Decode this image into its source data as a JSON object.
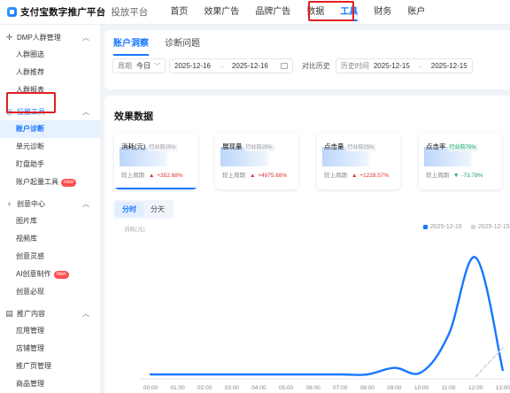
{
  "header": {
    "brand": "支付宝数字推广平台",
    "subtitle": "投放平台",
    "nav": [
      "首页",
      "效果广告",
      "品牌广告",
      "数据",
      "工具",
      "财务",
      "账户"
    ],
    "active_nav": "工具"
  },
  "sidebar": {
    "groups": [
      {
        "title": "DMP人群管理",
        "icon": "crosshair-icon",
        "items": [
          "人群圈选",
          "人群推荐",
          "人群报表"
        ]
      },
      {
        "title": "投放工具",
        "icon": "target-icon",
        "items": [
          "账户诊断",
          "单元诊断",
          "盯盘助手",
          "账户起量工具"
        ]
      },
      {
        "title": "创意中心",
        "icon": "bulb-icon",
        "items": [
          "图片库",
          "视频库",
          "创意灵感",
          "AI创意制作",
          "创意必现"
        ]
      },
      {
        "title": "推广内容",
        "icon": "doc-icon",
        "items": [
          "应用管理",
          "店铺管理",
          "推广页管理",
          "商品管理"
        ]
      }
    ],
    "active_item": "账户诊断",
    "badge_new": "new"
  },
  "tabs": [
    "账户洞察",
    "诊断问题"
  ],
  "filters": {
    "period_label": "周期",
    "period_value": "今日",
    "start": "2025-12-16",
    "end": "2025-12-16",
    "compare_label": "对比历史",
    "hist_label": "历史时间",
    "hist_start": "2025-12-15",
    "hist_end": "2025-12-15"
  },
  "section_title": "效果数据",
  "metrics": [
    {
      "name": "消耗(元)",
      "industry": "行业前25%",
      "compare_label": "较上周期",
      "change": "+352.68%",
      "trend": "up",
      "selected": true
    },
    {
      "name": "展现量",
      "industry": "行业前25%",
      "compare_label": "较上周期",
      "change": "+4975.68%",
      "trend": "up",
      "selected": false
    },
    {
      "name": "点击量",
      "industry": "行业前25%",
      "compare_label": "较上周期",
      "change": "+1228.57%",
      "trend": "up",
      "selected": false
    },
    {
      "name": "点击率",
      "industry": "行业前75%",
      "compare_label": "较上周期",
      "change": "-73.78%",
      "trend": "down",
      "selected": false
    }
  ],
  "segment": [
    "分时",
    "分天"
  ],
  "chart_data": {
    "type": "line",
    "ylabel": "消耗(元)",
    "x": [
      "00:00",
      "01:00",
      "02:00",
      "03:00",
      "04:00",
      "05:00",
      "06:00",
      "07:00",
      "08:00",
      "09:00",
      "10:00",
      "11:00",
      "12:00",
      "13:00"
    ],
    "series": [
      {
        "name": "2025-12-16",
        "color": "#1677ff",
        "values": [
          4,
          4,
          4,
          4,
          4,
          4,
          4,
          4,
          4,
          10,
          6,
          40,
          110,
          8
        ]
      },
      {
        "name": "2025-12-15",
        "color": "#cfd5de",
        "values": [
          null,
          null,
          null,
          null,
          null,
          null,
          null,
          null,
          null,
          null,
          null,
          null,
          2,
          28
        ]
      }
    ],
    "ylim": [
      0,
      130
    ],
    "grid": false
  }
}
